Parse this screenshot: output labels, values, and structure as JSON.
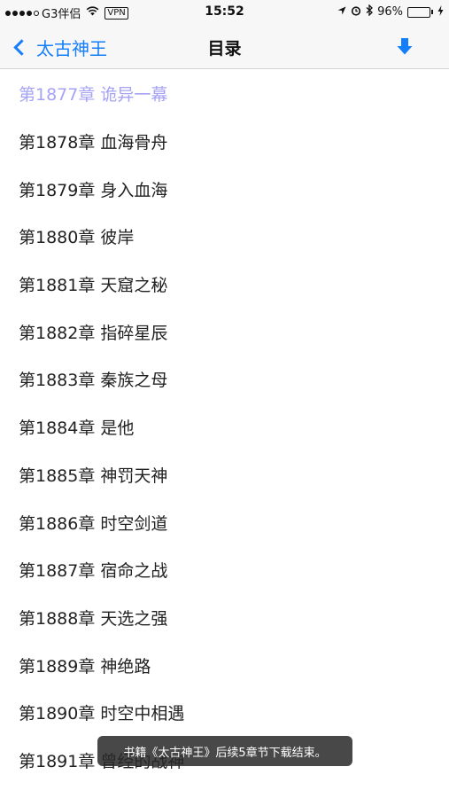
{
  "status_bar": {
    "carrier": "G3伴侣",
    "wifi_icon": "wifi-icon",
    "vpn": "VPN",
    "time": "15:52",
    "battery_percent": "96%",
    "battery_level": 0.96,
    "battery_color": "#4cd964"
  },
  "nav": {
    "back_label": "太古神王",
    "title": "目录",
    "accent_color": "#147efb"
  },
  "chapters": [
    {
      "label": "第1877章 诡异一幕",
      "current": true
    },
    {
      "label": "第1878章 血海骨舟"
    },
    {
      "label": "第1879章 身入血海"
    },
    {
      "label": "第1880章 彼岸"
    },
    {
      "label": "第1881章 天窟之秘"
    },
    {
      "label": "第1882章 指碎星辰"
    },
    {
      "label": "第1883章 秦族之母"
    },
    {
      "label": "第1884章 是他"
    },
    {
      "label": "第1885章 神罚天神"
    },
    {
      "label": "第1886章 时空剑道"
    },
    {
      "label": "第1887章 宿命之战"
    },
    {
      "label": "第1888章 天选之强"
    },
    {
      "label": "第1889章 神绝路"
    },
    {
      "label": "第1890章 时空中相遇"
    },
    {
      "label": "第1891章 曾经的战神"
    }
  ],
  "toast": {
    "message": "书籍《太古神王》后续5章节下载结束。"
  }
}
